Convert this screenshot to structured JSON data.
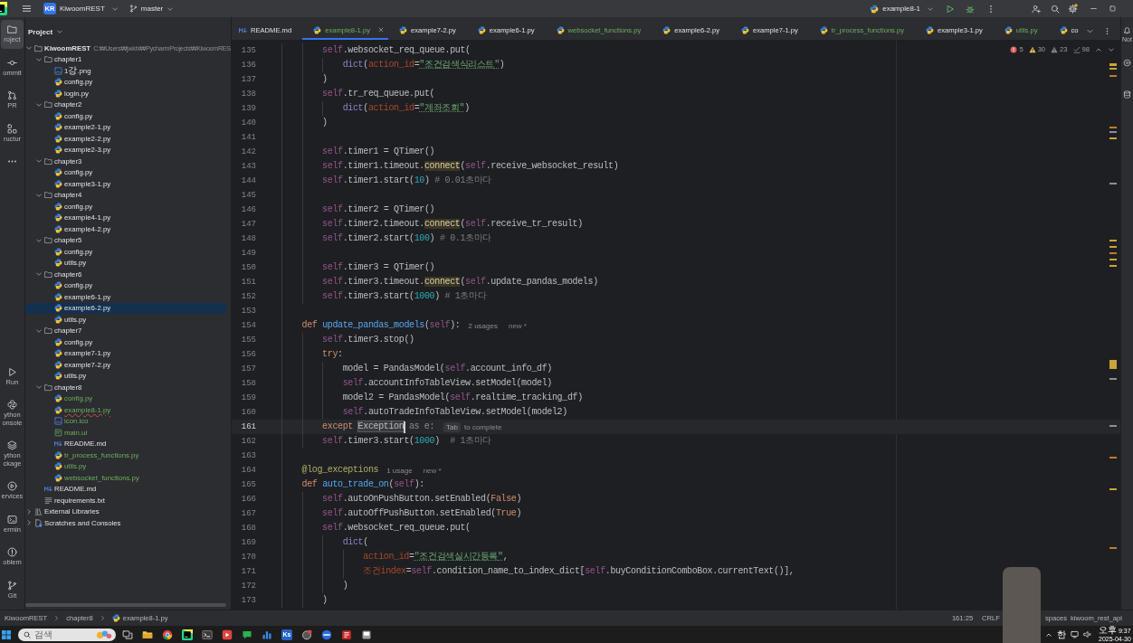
{
  "title_bar": {
    "project_badge": "KR",
    "project": "KiwoomREST",
    "branch": "master",
    "run_configuration": "example8-1"
  },
  "tool_strip": {
    "top": [
      {
        "kind": "project",
        "label": "roject",
        "selected": true
      },
      {
        "kind": "commit",
        "label": "ommit",
        "selected": false
      },
      {
        "kind": "pull-requests",
        "label": "PR",
        "selected": false
      },
      {
        "kind": "structure",
        "label": "ructur",
        "selected": false
      },
      {
        "kind": "more",
        "selected": false
      }
    ],
    "bottom": [
      {
        "kind": "run",
        "label": "Run",
        "selected": false
      },
      {
        "kind": "python-console",
        "label": "ython onsole",
        "selected": false
      },
      {
        "kind": "python-packages",
        "label": "ython ckage",
        "selected": false
      },
      {
        "kind": "services",
        "label": "ervices",
        "selected": false
      },
      {
        "kind": "terminal",
        "label": "ermin",
        "selected": false
      },
      {
        "kind": "problems",
        "label": "oblem",
        "selected": false
      },
      {
        "kind": "git",
        "label": "Git",
        "selected": false
      }
    ]
  },
  "project_panel": {
    "title": "Project",
    "tree": [
      {
        "label": "KiwoomREST",
        "kind": "folder",
        "path": "C:₩Users₩jwkhl₩PycharmProjects₩KiwoomRES",
        "expanded": true,
        "selected": false,
        "added": false,
        "error": false,
        "children": [
          {
            "label": "chapter1",
            "kind": "folder",
            "expanded": true,
            "selected": false,
            "added": false,
            "error": false,
            "children": [
              {
                "label": "1강.png",
                "kind": "image",
                "selected": false,
                "added": false,
                "error": false
              },
              {
                "label": "config.py",
                "kind": "python",
                "selected": false,
                "added": false,
                "error": false
              },
              {
                "label": "login.py",
                "kind": "python",
                "selected": false,
                "added": false,
                "error": false
              }
            ]
          },
          {
            "label": "chapter2",
            "kind": "folder",
            "expanded": true,
            "selected": false,
            "added": false,
            "error": false,
            "children": [
              {
                "label": "config.py",
                "kind": "python",
                "selected": false,
                "added": false,
                "error": false
              },
              {
                "label": "example2-1.py",
                "kind": "python",
                "selected": false,
                "added": false,
                "error": false
              },
              {
                "label": "example2-2.py",
                "kind": "python",
                "selected": false,
                "added": false,
                "error": false
              },
              {
                "label": "example2-3.py",
                "kind": "python",
                "selected": false,
                "added": false,
                "error": false
              }
            ]
          },
          {
            "label": "chapter3",
            "kind": "folder",
            "expanded": true,
            "selected": false,
            "added": false,
            "error": false,
            "children": [
              {
                "label": "config.py",
                "kind": "python",
                "selected": false,
                "added": false,
                "error": false
              },
              {
                "label": "example3-1.py",
                "kind": "python",
                "selected": false,
                "added": false,
                "error": false
              }
            ]
          },
          {
            "label": "chapter4",
            "kind": "folder",
            "expanded": true,
            "selected": false,
            "added": false,
            "error": false,
            "children": [
              {
                "label": "config.py",
                "kind": "python",
                "selected": false,
                "added": false,
                "error": false
              },
              {
                "label": "example4-1.py",
                "kind": "python",
                "selected": false,
                "added": false,
                "error": false
              },
              {
                "label": "example4-2.py",
                "kind": "python",
                "selected": false,
                "added": false,
                "error": false
              }
            ]
          },
          {
            "label": "chapter5",
            "kind": "folder",
            "expanded": true,
            "selected": false,
            "added": false,
            "error": false,
            "children": [
              {
                "label": "config.py",
                "kind": "python",
                "selected": false,
                "added": false,
                "error": false
              },
              {
                "label": "utils.py",
                "kind": "python",
                "selected": false,
                "added": false,
                "error": false
              }
            ]
          },
          {
            "label": "chapter6",
            "kind": "folder",
            "expanded": true,
            "selected": false,
            "added": false,
            "error": false,
            "children": [
              {
                "label": "config.py",
                "kind": "python",
                "selected": false,
                "added": false,
                "error": false
              },
              {
                "label": "example6-1.py",
                "kind": "python",
                "selected": false,
                "added": false,
                "error": false
              },
              {
                "label": "example6-2.py",
                "kind": "python",
                "selected": true,
                "added": false,
                "error": false
              },
              {
                "label": "utils.py",
                "kind": "python",
                "selected": false,
                "added": false,
                "error": false
              }
            ]
          },
          {
            "label": "chapter7",
            "kind": "folder",
            "expanded": true,
            "selected": false,
            "added": false,
            "error": false,
            "children": [
              {
                "label": "config.py",
                "kind": "python",
                "selected": false,
                "added": false,
                "error": false
              },
              {
                "label": "example7-1.py",
                "kind": "python",
                "selected": false,
                "added": false,
                "error": false
              },
              {
                "label": "example7-2.py",
                "kind": "python",
                "selected": false,
                "added": false,
                "error": false
              },
              {
                "label": "utils.py",
                "kind": "python",
                "selected": false,
                "added": false,
                "error": false
              }
            ]
          },
          {
            "label": "chapter8",
            "kind": "folder",
            "expanded": true,
            "selected": false,
            "added": false,
            "error": false,
            "children": [
              {
                "label": "config.py",
                "kind": "python",
                "selected": false,
                "added": true,
                "error": false
              },
              {
                "label": "example8-1.py",
                "kind": "python",
                "selected": false,
                "added": true,
                "error": true
              },
              {
                "label": "icon.ico",
                "kind": "image",
                "selected": false,
                "added": true,
                "error": false
              },
              {
                "label": "main.ui",
                "kind": "ui",
                "selected": false,
                "added": true,
                "error": false
              },
              {
                "label": "README.md",
                "kind": "markdown",
                "selected": false,
                "added": false,
                "error": false
              },
              {
                "label": "tr_process_functions.py",
                "kind": "python",
                "selected": false,
                "added": true,
                "error": false
              },
              {
                "label": "utils.py",
                "kind": "python",
                "selected": false,
                "added": true,
                "error": false
              },
              {
                "label": "websocket_functions.py",
                "kind": "python",
                "selected": false,
                "added": true,
                "error": false
              }
            ]
          },
          {
            "label": "README.md",
            "kind": "markdown",
            "selected": false,
            "added": false,
            "error": false
          },
          {
            "label": "requirements.txt",
            "kind": "text",
            "selected": false,
            "added": false,
            "error": false
          }
        ]
      },
      {
        "label": "External Libraries",
        "kind": "library",
        "expanded": false,
        "selected": false,
        "added": false,
        "error": false
      },
      {
        "label": "Scratches and Consoles",
        "kind": "scratch",
        "expanded": false,
        "selected": false,
        "added": false,
        "error": false
      }
    ]
  },
  "editor": {
    "tabs": [
      {
        "label": "README.md",
        "kind": "markdown",
        "selected": false,
        "added": false
      },
      {
        "label": "example8-1.py",
        "kind": "python",
        "selected": true,
        "added": true
      },
      {
        "label": "example7-2.py",
        "kind": "python",
        "selected": false,
        "added": false
      },
      {
        "label": "example6-1.py",
        "kind": "python",
        "selected": false,
        "added": false
      },
      {
        "label": "websocket_functions.py",
        "kind": "python",
        "selected": false,
        "added": true
      },
      {
        "label": "example6-2.py",
        "kind": "python",
        "selected": false,
        "added": false
      },
      {
        "label": "example7-1.py",
        "kind": "python",
        "selected": false,
        "added": false
      },
      {
        "label": "tr_process_functions.py",
        "kind": "python",
        "selected": false,
        "added": true
      },
      {
        "label": "example3-1.py",
        "kind": "python",
        "selected": false,
        "added": false
      },
      {
        "label": "utils.py",
        "kind": "python",
        "selected": false,
        "added": true
      },
      {
        "label": "co",
        "kind": "python",
        "selected": false,
        "added": false
      }
    ],
    "inspections": {
      "errors": "5",
      "warnings": "30",
      "weak_warnings": "23",
      "typos": "98"
    },
    "lines": [
      {
        "number": "135",
        "current": false,
        "tokens": [
          {
            "text": "        self",
            "kind": "self"
          },
          {
            "text": ".websocket_req_queue.put(",
            "kind": "plain"
          }
        ]
      },
      {
        "number": "136",
        "current": false,
        "tokens": [
          {
            "text": "            dict",
            "kind": "builtin"
          },
          {
            "text": "(",
            "kind": "plain"
          },
          {
            "text": "action_id",
            "kind": "param"
          },
          {
            "text": "=",
            "kind": "plain"
          },
          {
            "text": "\"조건검색식리스트\"",
            "kind": "typo"
          },
          {
            "text": ")",
            "kind": "plain"
          }
        ]
      },
      {
        "number": "137",
        "current": false,
        "tokens": [
          {
            "text": "        )",
            "kind": "plain"
          }
        ]
      },
      {
        "number": "138",
        "current": false,
        "tokens": [
          {
            "text": "        self",
            "kind": "self"
          },
          {
            "text": ".tr_req_queue.put(",
            "kind": "plain"
          }
        ]
      },
      {
        "number": "139",
        "current": false,
        "tokens": [
          {
            "text": "            dict",
            "kind": "builtin"
          },
          {
            "text": "(",
            "kind": "plain"
          },
          {
            "text": "action_id",
            "kind": "param"
          },
          {
            "text": "=",
            "kind": "plain"
          },
          {
            "text": "\"계좌조회\"",
            "kind": "typo"
          },
          {
            "text": ")",
            "kind": "plain"
          }
        ]
      },
      {
        "number": "140",
        "current": false,
        "tokens": [
          {
            "text": "        )",
            "kind": "plain"
          }
        ]
      },
      {
        "number": "141",
        "current": false
      },
      {
        "number": "142",
        "current": false,
        "tokens": [
          {
            "text": "        self",
            "kind": "self"
          },
          {
            "text": ".timer1 = QTimer()",
            "kind": "plain"
          }
        ]
      },
      {
        "number": "143",
        "current": false,
        "tokens": [
          {
            "text": "        self",
            "kind": "self"
          },
          {
            "text": ".timer1.timeout.",
            "kind": "plain"
          },
          {
            "text": "connect",
            "kind": "warn"
          },
          {
            "text": "(",
            "kind": "plain"
          },
          {
            "text": "self",
            "kind": "self"
          },
          {
            "text": ".receive_websocket_result)",
            "kind": "plain"
          }
        ]
      },
      {
        "number": "144",
        "current": false,
        "tokens": [
          {
            "text": "        self",
            "kind": "self"
          },
          {
            "text": ".timer1.start(",
            "kind": "plain"
          },
          {
            "text": "10",
            "kind": "num"
          },
          {
            "text": ") ",
            "kind": "plain"
          },
          {
            "text": "# 0.01초마다",
            "kind": "comment"
          }
        ]
      },
      {
        "number": "145",
        "current": false
      },
      {
        "number": "146",
        "current": false,
        "tokens": [
          {
            "text": "        self",
            "kind": "self"
          },
          {
            "text": ".timer2 = QTimer()",
            "kind": "plain"
          }
        ]
      },
      {
        "number": "147",
        "current": false,
        "tokens": [
          {
            "text": "        self",
            "kind": "self"
          },
          {
            "text": ".timer2.timeout.",
            "kind": "plain"
          },
          {
            "text": "connect",
            "kind": "warn"
          },
          {
            "text": "(",
            "kind": "plain"
          },
          {
            "text": "self",
            "kind": "self"
          },
          {
            "text": ".receive_tr_result)",
            "kind": "plain"
          }
        ]
      },
      {
        "number": "148",
        "current": false,
        "tokens": [
          {
            "text": "        self",
            "kind": "self"
          },
          {
            "text": ".timer2.start(",
            "kind": "plain"
          },
          {
            "text": "100",
            "kind": "num"
          },
          {
            "text": ") ",
            "kind": "plain"
          },
          {
            "text": "# 0.1초마다",
            "kind": "comment"
          }
        ]
      },
      {
        "number": "149",
        "current": false
      },
      {
        "number": "150",
        "current": false,
        "tokens": [
          {
            "text": "        self",
            "kind": "self"
          },
          {
            "text": ".timer3 = QTimer()",
            "kind": "plain"
          }
        ]
      },
      {
        "number": "151",
        "current": false,
        "tokens": [
          {
            "text": "        self",
            "kind": "self"
          },
          {
            "text": ".timer3.timeout.",
            "kind": "plain"
          },
          {
            "text": "connect",
            "kind": "warn"
          },
          {
            "text": "(",
            "kind": "plain"
          },
          {
            "text": "self",
            "kind": "self"
          },
          {
            "text": ".update_pandas_models)",
            "kind": "plain"
          }
        ]
      },
      {
        "number": "152",
        "current": false,
        "tokens": [
          {
            "text": "        self",
            "kind": "self"
          },
          {
            "text": ".timer3.start(",
            "kind": "plain"
          },
          {
            "text": "1000",
            "kind": "num"
          },
          {
            "text": ") ",
            "kind": "plain"
          },
          {
            "text": "# 1초마다",
            "kind": "comment"
          }
        ]
      },
      {
        "number": "153",
        "current": false
      },
      {
        "number": "154",
        "current": false,
        "tokens": [
          {
            "text": "    def ",
            "kind": "kw"
          },
          {
            "text": "update_pandas_models",
            "kind": "fn"
          },
          {
            "text": "(",
            "kind": "plain"
          },
          {
            "text": "self",
            "kind": "self"
          },
          {
            "text": "):",
            "kind": "plain"
          }
        ],
        "hints": [
          {
            "text": "2 usages",
            "kind": "usages"
          },
          {
            "text": "new *",
            "kind": "author"
          }
        ]
      },
      {
        "number": "155",
        "current": false,
        "tokens": [
          {
            "text": "        self",
            "kind": "self"
          },
          {
            "text": ".timer3.stop()",
            "kind": "plain"
          }
        ]
      },
      {
        "number": "156",
        "current": false,
        "tokens": [
          {
            "text": "        try",
            "kind": "kw"
          },
          {
            "text": ":",
            "kind": "plain"
          }
        ]
      },
      {
        "number": "157",
        "current": false,
        "tokens": [
          {
            "text": "            model = PandasModel(",
            "kind": "plain"
          },
          {
            "text": "self",
            "kind": "self"
          },
          {
            "text": ".account_info_df)",
            "kind": "plain"
          }
        ]
      },
      {
        "number": "158",
        "current": false,
        "tokens": [
          {
            "text": "            self",
            "kind": "self"
          },
          {
            "text": ".accountInfoTableView.setModel(model)",
            "kind": "plain"
          }
        ]
      },
      {
        "number": "159",
        "current": false,
        "tokens": [
          {
            "text": "            model2 = PandasModel(",
            "kind": "plain"
          },
          {
            "text": "self",
            "kind": "self"
          },
          {
            "text": ".realtime_tracking_df)",
            "kind": "plain"
          }
        ]
      },
      {
        "number": "160",
        "current": false,
        "tokens": [
          {
            "text": "            self",
            "kind": "self"
          },
          {
            "text": ".autoTradeInfoTableView.setModel(model2)",
            "kind": "plain"
          }
        ]
      },
      {
        "number": "161",
        "current": true,
        "tokens": [
          {
            "text": "        except ",
            "kind": "kw"
          },
          {
            "text": "Exception",
            "kind": "match"
          },
          {
            "text": "as e:",
            "kind": "ghost"
          }
        ],
        "completion_hint": {
          "key": "Tab",
          "text": "to complete"
        }
      },
      {
        "number": "162",
        "current": false,
        "tokens": [
          {
            "text": "        self",
            "kind": "self"
          },
          {
            "text": ".timer3.start(",
            "kind": "plain"
          },
          {
            "text": "1000",
            "kind": "num"
          },
          {
            "text": ")  ",
            "kind": "plain"
          },
          {
            "text": "# 1초마다",
            "kind": "comment"
          }
        ]
      },
      {
        "number": "163",
        "current": false
      },
      {
        "number": "164",
        "current": false,
        "tokens": [
          {
            "text": "    @log_exceptions",
            "kind": "deco"
          }
        ],
        "hints": [
          {
            "text": "1 usage",
            "kind": "usages"
          },
          {
            "text": "new *",
            "kind": "author"
          }
        ]
      },
      {
        "number": "165",
        "current": false,
        "tokens": [
          {
            "text": "    def ",
            "kind": "kw"
          },
          {
            "text": "auto_trade_on",
            "kind": "fn"
          },
          {
            "text": "(",
            "kind": "plain"
          },
          {
            "text": "self",
            "kind": "self"
          },
          {
            "text": "):",
            "kind": "plain"
          }
        ]
      },
      {
        "number": "166",
        "current": false,
        "tokens": [
          {
            "text": "        self",
            "kind": "self"
          },
          {
            "text": ".autoOnPushButton.setEnabled(",
            "kind": "plain"
          },
          {
            "text": "False",
            "kind": "kw"
          },
          {
            "text": ")",
            "kind": "plain"
          }
        ]
      },
      {
        "number": "167",
        "current": false,
        "tokens": [
          {
            "text": "        self",
            "kind": "self"
          },
          {
            "text": ".autoOffPushButton.setEnabled(",
            "kind": "plain"
          },
          {
            "text": "True",
            "kind": "kw"
          },
          {
            "text": ")",
            "kind": "plain"
          }
        ]
      },
      {
        "number": "168",
        "current": false,
        "tokens": [
          {
            "text": "        self",
            "kind": "self"
          },
          {
            "text": ".websocket_req_queue.put(",
            "kind": "plain"
          }
        ]
      },
      {
        "number": "169",
        "current": false,
        "tokens": [
          {
            "text": "            dict",
            "kind": "builtin"
          },
          {
            "text": "(",
            "kind": "plain"
          }
        ]
      },
      {
        "number": "170",
        "current": false,
        "tokens": [
          {
            "text": "                action_id",
            "kind": "param"
          },
          {
            "text": "=",
            "kind": "plain"
          },
          {
            "text": "\"조건검색실시간등록\"",
            "kind": "typo"
          },
          {
            "text": ",",
            "kind": "plain"
          }
        ]
      },
      {
        "number": "171",
        "current": false,
        "tokens": [
          {
            "text": "                조건index",
            "kind": "param"
          },
          {
            "text": "=",
            "kind": "plain"
          },
          {
            "text": "self",
            "kind": "self"
          },
          {
            "text": ".condition_name_to_index_dict[",
            "kind": "plain"
          },
          {
            "text": "self",
            "kind": "self"
          },
          {
            "text": ".buyConditionComboBox.currentText()],",
            "kind": "plain"
          }
        ]
      },
      {
        "number": "172",
        "current": false,
        "tokens": [
          {
            "text": "            )",
            "kind": "plain"
          }
        ]
      },
      {
        "number": "173",
        "current": false,
        "tokens": [
          {
            "text": "        )",
            "kind": "plain"
          }
        ]
      }
    ]
  },
  "right_strip": {
    "items": [
      {
        "kind": "notifications",
        "label": "Not"
      },
      {
        "kind": "assistant"
      },
      {
        "kind": "database"
      }
    ]
  },
  "status_bar": {
    "breadcrumbs": [
      {
        "label": "KiwoomREST",
        "kind": "project"
      },
      {
        "label": "chapter8",
        "kind": "folder"
      },
      {
        "label": "example8-1.py",
        "kind": "python"
      }
    ],
    "position": "161:25",
    "line_separator": "CRLF",
    "indentation": "spaces",
    "interpreter": "kiwoom_rest_api"
  },
  "taskbar": {
    "search": {
      "placeholder": "검색"
    },
    "apps": [
      {
        "kind": "task-view"
      },
      {
        "kind": "file-explorer"
      },
      {
        "kind": "browser"
      },
      {
        "kind": "ide"
      },
      {
        "kind": "terminal"
      },
      {
        "kind": "video"
      },
      {
        "kind": "chat"
      },
      {
        "kind": "chart"
      },
      {
        "kind": "text-tile",
        "label": "Ks"
      },
      {
        "kind": "badge-app"
      },
      {
        "kind": "round-app"
      },
      {
        "kind": "document-tile"
      },
      {
        "kind": "window-tile"
      }
    ],
    "input_method": "한",
    "clock": {
      "time": "오후 9:37",
      "date": "2025-04-30"
    }
  }
}
